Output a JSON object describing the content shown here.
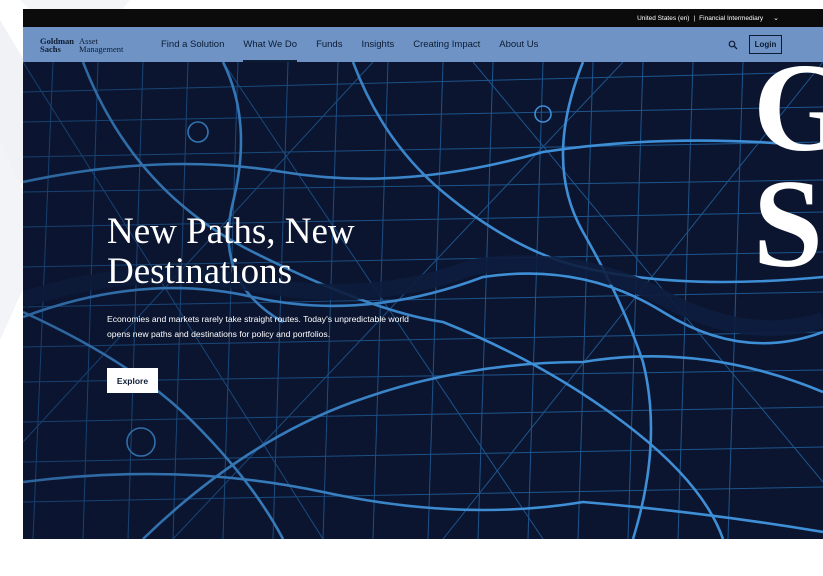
{
  "utility": {
    "region": "United States (en)",
    "separator": "|",
    "audience": "Financial Intermediary",
    "chevron": "⌄"
  },
  "nav": {
    "logo_line1_left": "Goldman",
    "logo_line2_left": "Sachs",
    "logo_line1_right": "Asset",
    "logo_line2_right": "Management",
    "items": [
      {
        "label": "Find a Solution"
      },
      {
        "label": "What We Do"
      },
      {
        "label": "Funds"
      },
      {
        "label": "Insights"
      },
      {
        "label": "Creating Impact"
      },
      {
        "label": "About Us"
      }
    ],
    "active_index": 1,
    "search_icon": "search-icon",
    "login_label": "Login"
  },
  "hero": {
    "title_line1": "New Paths, New",
    "title_line2": "Destinations",
    "subtitle_line1": "Economies and markets rarely take straight routes. Today's unpredictable world",
    "subtitle_line2": "opens new paths and destinations for policy and portfolios.",
    "cta_label": "Explore",
    "monogram_top": "G",
    "monogram_bottom": "S"
  },
  "colors": {
    "nav_bg": "#6f93c5",
    "hero_bg": "#0b1530",
    "map_lines": "#3f8fd6",
    "utility_bg": "#0b0b0b"
  }
}
